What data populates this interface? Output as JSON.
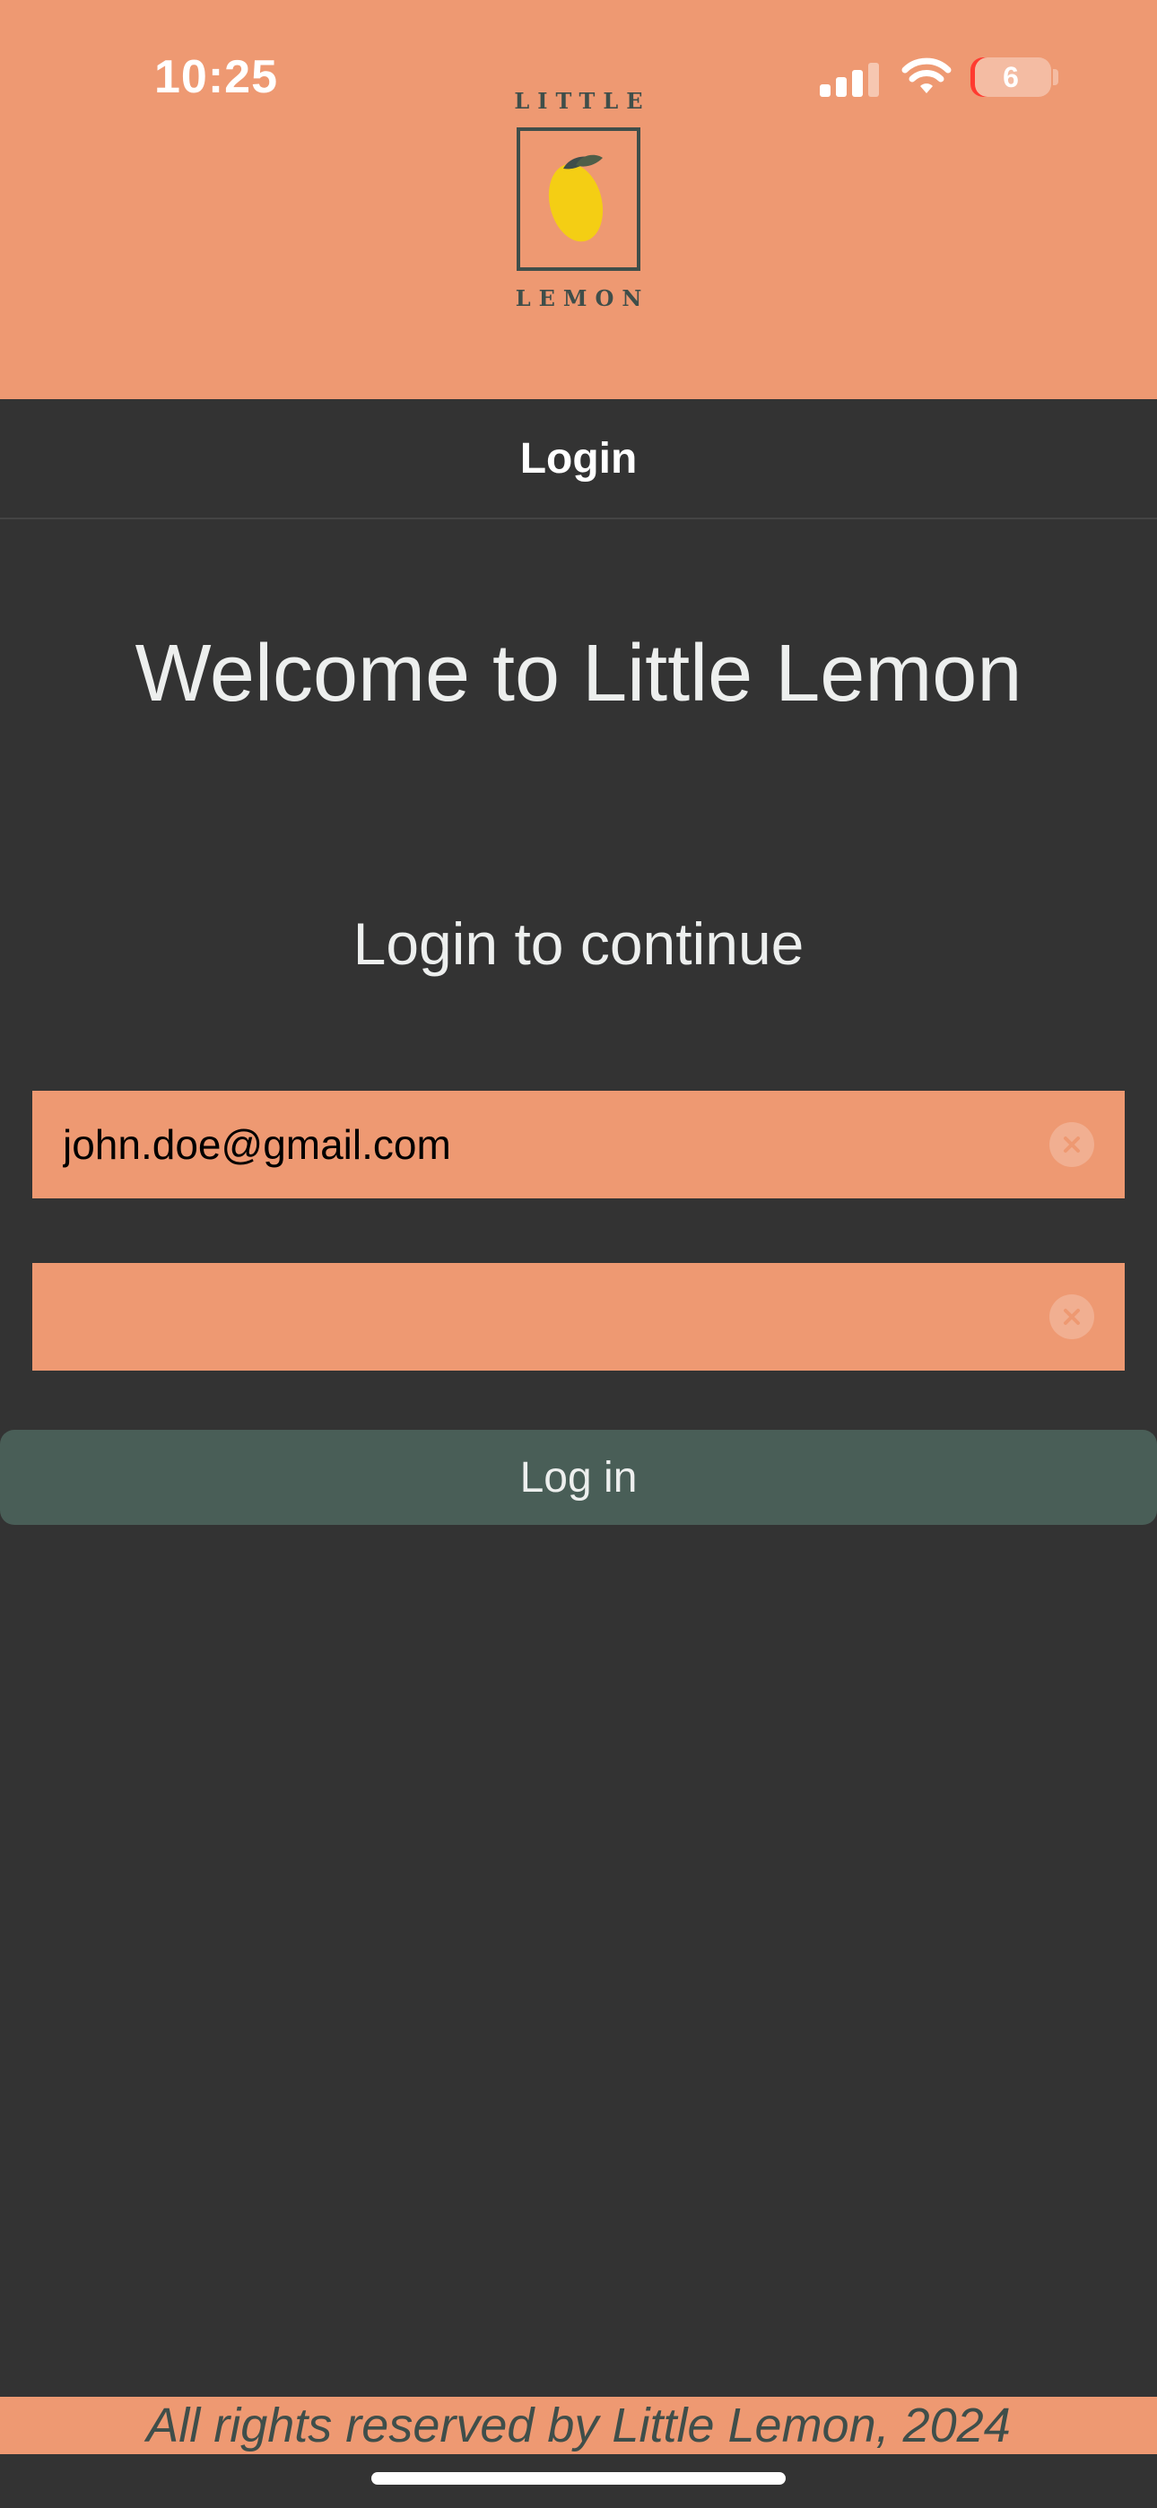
{
  "status_bar": {
    "time": "10:25",
    "battery": "6",
    "icons": [
      "cellular-signal-icon",
      "wifi-icon",
      "battery-icon"
    ]
  },
  "logo": {
    "line1": "LITTLE",
    "line2": "LEMON",
    "icon": "lemon-icon"
  },
  "nav": {
    "title": "Login"
  },
  "main": {
    "welcome": "Welcome to Little Lemon",
    "subtitle": "Login to continue",
    "email_value": "john.doe@gmail.com",
    "password_value": "",
    "clear_icon": "clear-x-icon",
    "login_button": "Log in"
  },
  "footer": {
    "text": "All rights reserved by Little Lemon, 2024"
  },
  "colors": {
    "primary_peach": "#EE9972",
    "background_dark": "#333333",
    "button_green": "#495E57",
    "logo_green": "#3F4E4A",
    "lemon_yellow": "#F4CE14",
    "text_light": "#EDEFEE"
  }
}
